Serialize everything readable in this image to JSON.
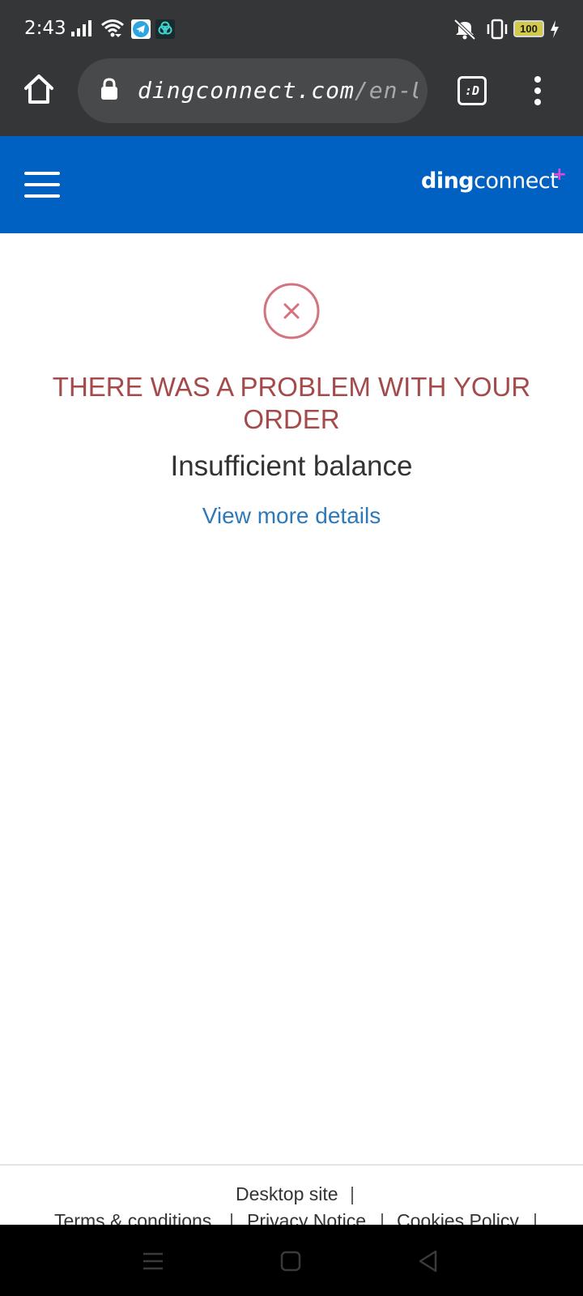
{
  "status_bar": {
    "time": "2:43",
    "battery_level": "100",
    "icons": [
      "signal-icon",
      "wifi-icon",
      "telegram-icon",
      "app-icon",
      "mute-icon",
      "vibrate-icon",
      "battery-icon",
      "charging-icon"
    ]
  },
  "browser": {
    "url_domain": "dingconnect.com",
    "url_path": "/en-U",
    "tab_switcher_label": ":D",
    "icons": [
      "home-icon",
      "lock-icon",
      "more-vertical-icon"
    ]
  },
  "header": {
    "logo_ding": "ding",
    "logo_connect": "connect",
    "logo_plus": "+",
    "brand_color": "#0061c2"
  },
  "main": {
    "error_title": "THERE WAS A PROBLEM WITH YOUR ORDER",
    "error_subtitle": "Insufficient balance",
    "details_link": "View more details",
    "error_color": "#a44a4a",
    "link_color": "#2e79b9"
  },
  "footer": {
    "desktop_site": "Desktop site",
    "terms": "Terms & conditions",
    "privacy": "Privacy Notice",
    "cookies": "Cookies Policy",
    "separator": "|"
  },
  "nav_bar": {
    "icons": [
      "recents-icon",
      "home-nav-icon",
      "back-icon"
    ]
  }
}
